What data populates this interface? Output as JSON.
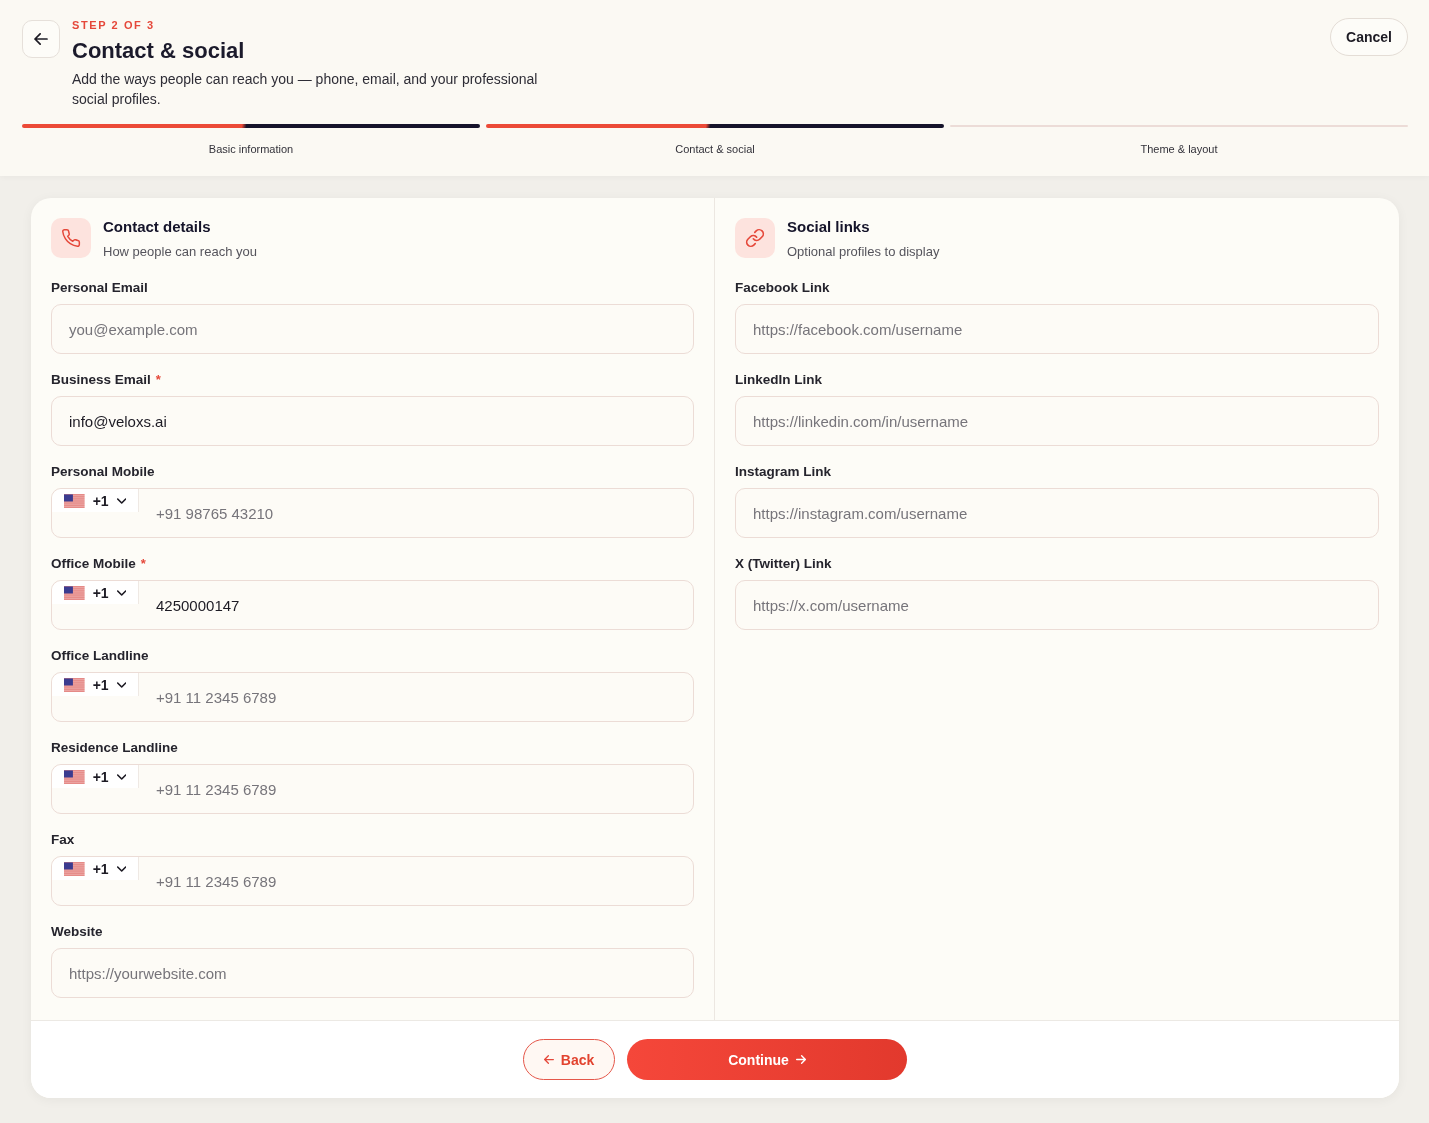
{
  "header": {
    "step": "STEP 2 OF 3",
    "title": "Contact & social",
    "description": "Add the ways people can reach you — phone, email, and your professional social profiles.",
    "cancel": "Cancel"
  },
  "steps": [
    {
      "label": "Basic information",
      "reached": true
    },
    {
      "label": "Contact & social",
      "reached": true
    },
    {
      "label": "Theme & layout",
      "reached": false
    }
  ],
  "sections": [
    {
      "title": "Contact details",
      "subtitle": "How people can reach you",
      "fields": [
        {
          "kind": "text",
          "label": "Personal Email",
          "placeholder": "you@example.com"
        },
        {
          "kind": "text",
          "label": "Business Email",
          "required_mark": "*",
          "value": "info@veloxs.ai"
        },
        {
          "kind": "phone",
          "label": "Personal Mobile",
          "country_code": "+1",
          "placeholder": "+91 98765 43210"
        },
        {
          "kind": "phone",
          "label": "Office Mobile",
          "required_mark": "*",
          "country_code": "+1",
          "value": "4250000147"
        },
        {
          "kind": "phone",
          "label": "Office Landline",
          "country_code": "+1",
          "placeholder": "+91 11 2345 6789"
        },
        {
          "kind": "phone",
          "label": "Residence Landline",
          "country_code": "+1",
          "placeholder": "+91 11 2345 6789"
        },
        {
          "kind": "phone",
          "label": "Fax",
          "country_code": "+1",
          "placeholder": "+91 11 2345 6789"
        },
        {
          "kind": "text",
          "label": "Website",
          "placeholder": "https://yourwebsite.com"
        }
      ]
    },
    {
      "title": "Social links",
      "subtitle": "Optional profiles to display",
      "fields": [
        {
          "kind": "text",
          "label": "Facebook Link",
          "placeholder": "https://facebook.com/username"
        },
        {
          "kind": "text",
          "label": "LinkedIn Link",
          "placeholder": "https://linkedin.com/in/username"
        },
        {
          "kind": "text",
          "label": "Instagram Link",
          "placeholder": "https://instagram.com/username"
        },
        {
          "kind": "text",
          "label": "X (Twitter) Link",
          "placeholder": "https://x.com/username"
        }
      ]
    }
  ],
  "footer": {
    "back": "Back",
    "continue": "Continue"
  }
}
